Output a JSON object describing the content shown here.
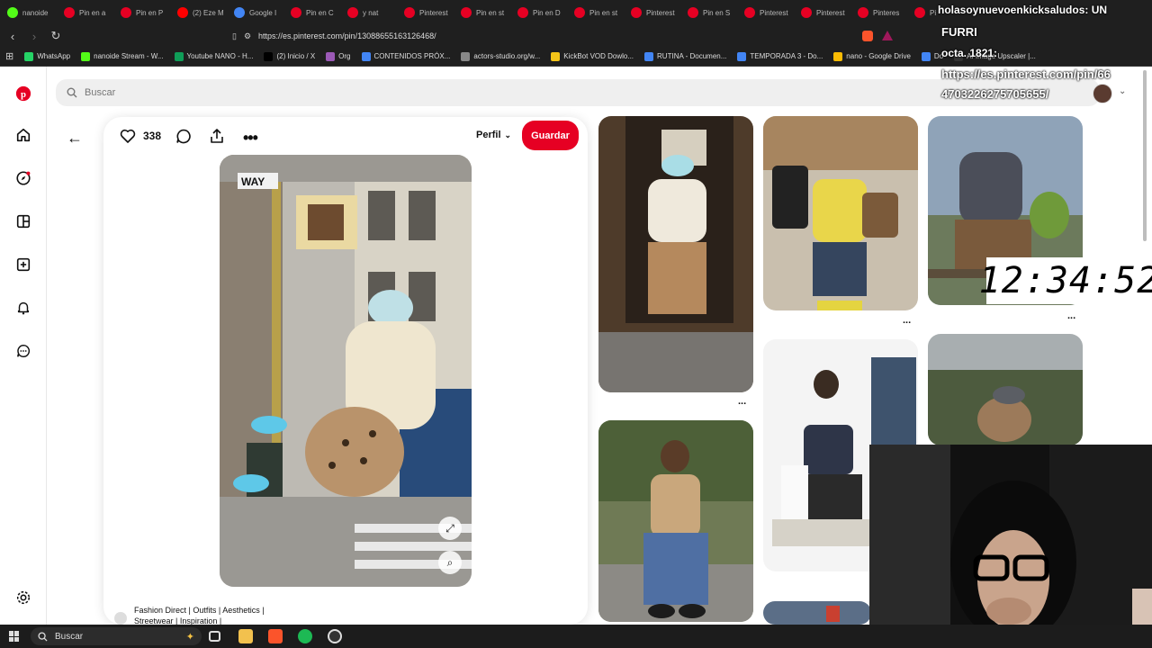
{
  "tabs": [
    {
      "label": "nanoide",
      "icon": "kick-icon",
      "color": "#53fc18"
    },
    {
      "label": "Pin en a",
      "icon": "pinterest-icon",
      "color": "#e60023"
    },
    {
      "label": "Pin en P",
      "icon": "pinterest-icon",
      "color": "#e60023"
    },
    {
      "label": "(2) Eze M",
      "icon": "youtube-icon",
      "color": "#ff0000"
    },
    {
      "label": "Google I",
      "icon": "google-icon",
      "color": "#4285f4"
    },
    {
      "label": "Pin en C",
      "icon": "pinterest-icon",
      "color": "#e60023"
    },
    {
      "label": "y nat",
      "icon": "pinterest-icon",
      "color": "#e60023"
    },
    {
      "label": "Pinterest",
      "icon": "pinterest-icon",
      "color": "#e60023"
    },
    {
      "label": "Pin en st",
      "icon": "pinterest-icon",
      "color": "#e60023"
    },
    {
      "label": "Pin en D",
      "icon": "pinterest-icon",
      "color": "#e60023"
    },
    {
      "label": "Pin en st",
      "icon": "pinterest-icon",
      "color": "#e60023"
    },
    {
      "label": "Pinterest",
      "icon": "pinterest-icon",
      "color": "#e60023"
    },
    {
      "label": "Pin en S",
      "icon": "pinterest-icon",
      "color": "#e60023"
    },
    {
      "label": "Pinterest",
      "icon": "pinterest-icon",
      "color": "#e60023"
    },
    {
      "label": "Pinterest",
      "icon": "pinterest-icon",
      "color": "#e60023"
    },
    {
      "label": "Pinteres",
      "icon": "pinterest-icon",
      "color": "#e60023"
    },
    {
      "label": "Pi",
      "icon": "pinterest-icon",
      "color": "#e60023"
    }
  ],
  "url": "https://es.pinterest.com/pin/13088655163126468/",
  "bookmarks": [
    {
      "label": "WhatsApp",
      "color": "#25d366"
    },
    {
      "label": "nanoide Stream - W...",
      "color": "#53fc18"
    },
    {
      "label": "Youtube NANO - H...",
      "color": "#0f9d58"
    },
    {
      "label": "(2) Inicio / X",
      "color": "#000000"
    },
    {
      "label": "Org",
      "color": "#9b59b6"
    },
    {
      "label": "CONTENIDOS PRÓX...",
      "color": "#4285f4"
    },
    {
      "label": "actors-studio.org/w...",
      "color": "#888888"
    },
    {
      "label": "KickBot VOD Dowlo...",
      "color": "#f5c518"
    },
    {
      "label": "RUTINA - Documen...",
      "color": "#4285f4"
    },
    {
      "label": "TEMPORADA 3 - Do...",
      "color": "#4285f4"
    },
    {
      "label": "nano - Google Drive",
      "color": "#fbbc04"
    },
    {
      "label": "Do",
      "color": "#4285f4"
    },
    {
      "label": "AI Image Upscaler |...",
      "color": "#333333"
    }
  ],
  "search": {
    "placeholder": "Buscar"
  },
  "pin": {
    "likes": "338",
    "profile_label": "Perfil",
    "save_label": "Guardar",
    "board_text": "Fashion Direct | Outfits | Aesthetics | Streetwear | Inspiration |"
  },
  "overlay": {
    "top_text": "holasoynuevoenkicksaludos: UN",
    "name": "FURRI",
    "date": "octa. 1821:",
    "url": "https://es.pinterest.com/pin/66 4703226275705655/",
    "clock": "12:34:52"
  },
  "taskbar": {
    "search_label": "Buscar"
  },
  "grid_more": "..."
}
